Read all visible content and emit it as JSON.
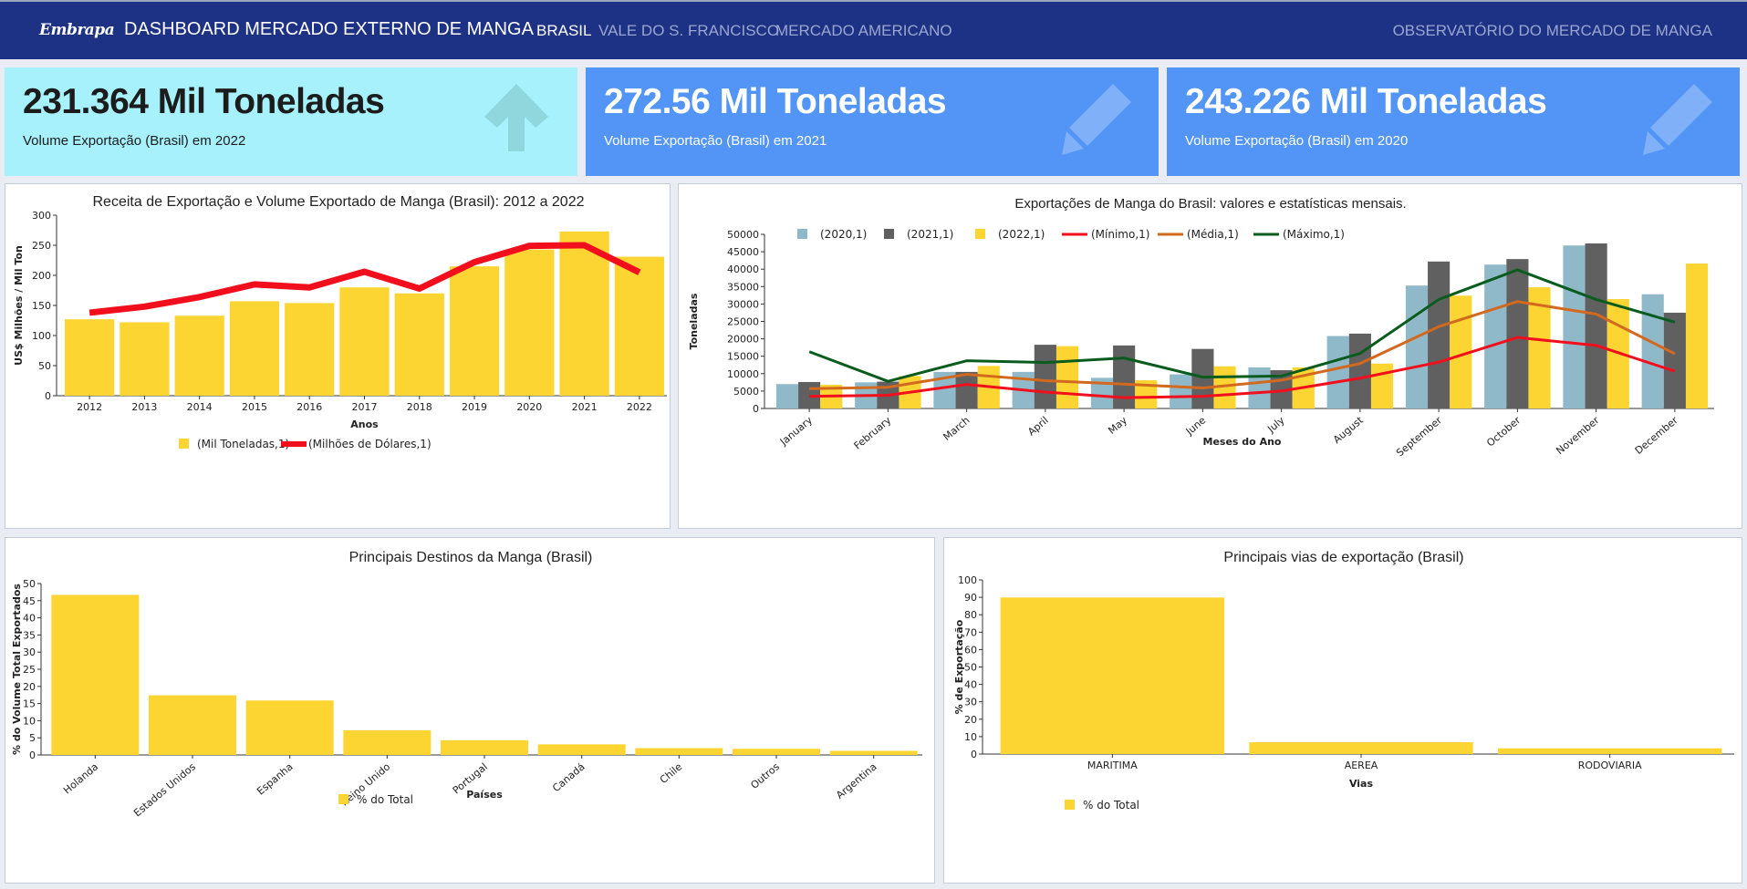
{
  "header": {
    "logo": "Embrapa",
    "title": "DASHBOARD MERCADO EXTERNO DE MANGA",
    "nav": [
      "BRASIL",
      "VALE DO S. FRANCISCO",
      "MERCADO AMERICANO"
    ],
    "active_nav": "BRASIL",
    "right_link": "OBSERVATÓRIO DO MERCADO DE MANGA"
  },
  "kpis": [
    {
      "value": "231.364 Mil Toneladas",
      "label": "Volume Exportação (Brasil) em 2022",
      "icon": "arrow-up-icon",
      "bg": "#a6f1fc"
    },
    {
      "value": "272.56 Mil Toneladas",
      "label": "Volume Exportação (Brasil) em 2021",
      "icon": "pencil-icon",
      "bg": "#5295f6"
    },
    {
      "value": "243.226 Mil Toneladas",
      "label": "Volume Exportação (Brasil) em 2020",
      "icon": "pencil-icon",
      "bg": "#5295f6"
    }
  ],
  "chart_data": [
    {
      "type": "bar",
      "title": "Receita de Exportação e Volume Exportado de Manga (Brasil): 2012 a 2022",
      "xlabel": "Anos",
      "ylabel": "US$ Milhões / Mil Ton",
      "ylim": [
        0,
        300
      ],
      "yticks": [
        0,
        50,
        100,
        150,
        200,
        250,
        300
      ],
      "categories": [
        "2012",
        "2013",
        "2014",
        "2015",
        "2016",
        "2017",
        "2018",
        "2019",
        "2020",
        "2021",
        "2022"
      ],
      "series": [
        {
          "name": "(Mil Toneladas,1)",
          "type": "bar",
          "color": "#fdd533",
          "values": [
            127,
            122,
            133,
            157,
            154,
            180,
            170,
            215,
            243,
            273,
            231
          ]
        },
        {
          "name": "(Milhões de Dólares,1)",
          "type": "line",
          "color": "#f10f1d",
          "values": [
            138,
            148,
            164,
            185,
            180,
            206,
            178,
            222,
            249,
            250,
            205
          ]
        }
      ],
      "legend": "bottom"
    },
    {
      "type": "bar",
      "title": "Exportações de Manga do Brasil: valores e estatísticas mensais.",
      "xlabel": "Meses do Ano",
      "ylabel": "Toneladas",
      "ylim": [
        0,
        50000
      ],
      "yticks": [
        0,
        5000,
        10000,
        15000,
        20000,
        25000,
        30000,
        35000,
        40000,
        45000,
        50000
      ],
      "categories": [
        "January",
        "February",
        "March",
        "April",
        "May",
        "June",
        "July",
        "August",
        "September",
        "October",
        "November",
        "December"
      ],
      "series": [
        {
          "name": "(2020,1)",
          "type": "bar",
          "color": "#8fb8c8",
          "values": [
            7000,
            7500,
            10500,
            10500,
            8800,
            9800,
            11800,
            20800,
            35300,
            41300,
            46800,
            32800
          ]
        },
        {
          "name": "(2021,1)",
          "type": "bar",
          "color": "#606060",
          "values": [
            7600,
            7700,
            10500,
            18300,
            18100,
            17100,
            11000,
            21500,
            42200,
            42900,
            47400,
            27500
          ]
        },
        {
          "name": "(2022,1)",
          "type": "bar",
          "color": "#fdd533",
          "values": [
            6800,
            9300,
            12200,
            17900,
            8100,
            12100,
            11800,
            12900,
            32400,
            34800,
            31400,
            41600
          ]
        },
        {
          "name": "(Mínimo,1)",
          "type": "line",
          "color": "#f10f1d",
          "values": [
            3500,
            3800,
            6900,
            4700,
            3100,
            3500,
            5000,
            8700,
            13300,
            20400,
            18100,
            10700
          ]
        },
        {
          "name": "(Média,1)",
          "type": "line",
          "color": "#d2691e",
          "values": [
            5700,
            6100,
            9800,
            8000,
            7000,
            5900,
            8100,
            12900,
            23500,
            30700,
            27100,
            15700
          ]
        },
        {
          "name": "(Máximo,1)",
          "type": "line",
          "color": "#0a5c1e",
          "values": [
            16300,
            7800,
            13700,
            13200,
            14500,
            9000,
            9300,
            15800,
            31300,
            39800,
            31300,
            24800
          ]
        }
      ],
      "legend": "top"
    },
    {
      "type": "bar",
      "title": "Principais Destinos da Manga (Brasil)",
      "xlabel": "Países",
      "ylabel": "% do Volume Total Exportados",
      "ylim": [
        0,
        50
      ],
      "yticks": [
        0,
        5,
        10,
        15,
        20,
        25,
        30,
        35,
        40,
        45,
        50
      ],
      "categories": [
        "Holanda",
        "Estados Unidos",
        "Espanha",
        "Reino Unido",
        "Portugal",
        "Canadá",
        "Chile",
        "Outros",
        "Argentina"
      ],
      "series": [
        {
          "name": "% do Total",
          "type": "bar",
          "color": "#fdd533",
          "values": [
            46.7,
            17.4,
            15.9,
            7.2,
            4.3,
            3.1,
            2.0,
            1.8,
            1.2
          ]
        }
      ],
      "legend": "bottom"
    },
    {
      "type": "bar",
      "title": "Principais vias de exportação (Brasil)",
      "xlabel": "Vias",
      "ylabel": "% de Exportação",
      "ylim": [
        0,
        100
      ],
      "yticks": [
        0,
        10,
        20,
        30,
        40,
        50,
        60,
        70,
        80,
        90,
        100
      ],
      "categories": [
        "MARITIMA",
        "AEREA",
        "RODOVIARIA"
      ],
      "series": [
        {
          "name": "% do Total",
          "type": "bar",
          "color": "#fdd533",
          "values": [
            89.9,
            6.8,
            3.3
          ]
        }
      ],
      "legend": "bottom"
    }
  ]
}
